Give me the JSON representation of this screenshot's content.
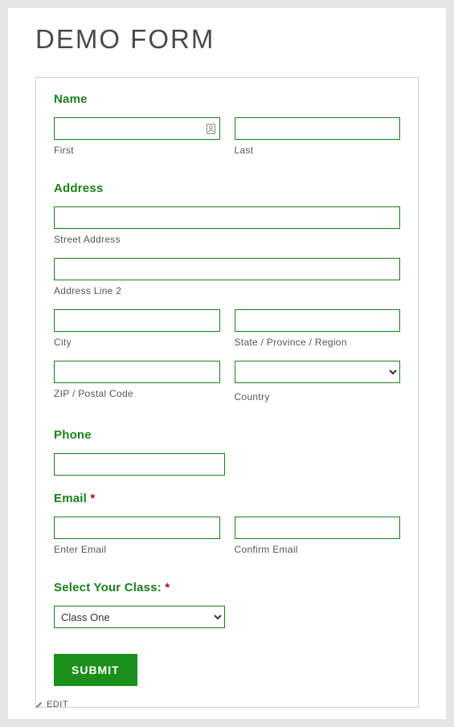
{
  "page_title": "DEMO FORM",
  "sections": {
    "name": {
      "heading": "Name",
      "first_label": "First",
      "last_label": "Last"
    },
    "address": {
      "heading": "Address",
      "street_label": "Street Address",
      "line2_label": "Address Line 2",
      "city_label": "City",
      "state_label": "State / Province / Region",
      "zip_label": "ZIP / Postal Code",
      "country_label": "Country",
      "country_options": [
        ""
      ]
    },
    "phone": {
      "heading": "Phone"
    },
    "email": {
      "heading": "Email",
      "required_star": "*",
      "enter_label": "Enter Email",
      "confirm_label": "Confirm Email"
    },
    "class": {
      "heading": "Select Your Class:",
      "required_star": "*",
      "selected_value": "Class One",
      "options": [
        "Class One"
      ]
    }
  },
  "submit_label": "SUBMIT",
  "edit_label": "EDIT",
  "colors": {
    "accent": "#1a8f1a",
    "border": "#1a7f1a"
  }
}
